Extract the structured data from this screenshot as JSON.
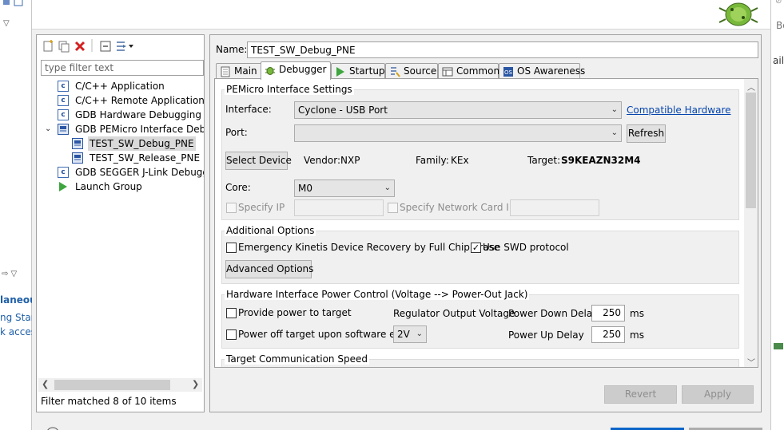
{
  "background": {
    "left_fragments": [
      "laneous",
      "ng Start",
      "k access"
    ],
    "right_fragments": [
      "Bo",
      "aila"
    ]
  },
  "left": {
    "filter_placeholder": "type filter text",
    "tree": [
      {
        "label": "C/C++ Application"
      },
      {
        "label": "C/C++ Remote Application"
      },
      {
        "label": "GDB Hardware Debugging"
      },
      {
        "label": "GDB PEMicro Interface Debugging"
      },
      {
        "label": "TEST_SW_Debug_PNE"
      },
      {
        "label": "TEST_SW_Release_PNE"
      },
      {
        "label": "GDB SEGGER J-Link Debugging"
      },
      {
        "label": "Launch Group"
      }
    ],
    "status": "Filter matched 8 of 10 items"
  },
  "right": {
    "name_label": "Name:",
    "name_value": "TEST_SW_Debug_PNE",
    "tabs": [
      "Main",
      "Debugger",
      "Startup",
      "Source",
      "Common",
      "OS Awareness"
    ],
    "pemicro": {
      "title": "PEMicro Interface Settings",
      "interface_label": "Interface:",
      "interface_value": "Cyclone - USB Port",
      "compat_link": "Compatible Hardware",
      "port_label": "Port:",
      "refresh": "Refresh",
      "select_device": "Select Device",
      "vendor_label": "Vendor:",
      "vendor_value": "NXP",
      "family_label": "Family:",
      "family_value": "KEx",
      "target_label": "Target:",
      "target_value": "S9KEAZN32M4",
      "core_label": "Core:",
      "core_value": "M0",
      "specify_ip": "Specify IP",
      "specify_network": "Specify Network Card IP"
    },
    "additional": {
      "title": "Additional Options",
      "emergency": "Emergency Kinetis Device Recovery by Full Chip Erase",
      "use_swd": "Use SWD protocol",
      "advanced": "Advanced Options"
    },
    "power": {
      "title": "Hardware Interface Power Control (Voltage --> Power-Out Jack)",
      "provide": "Provide power to target",
      "regulator": "Regulator Output Voltage",
      "power_down_label": "Power Down Delay",
      "power_down_value": "250",
      "ms1": "ms",
      "power_off": "Power off target upon software exit",
      "voltage": "2V",
      "power_up_label": "Power Up Delay",
      "power_up_value": "250",
      "ms2": "ms"
    },
    "speed_title": "Target Communication Speed",
    "revert": "Revert",
    "apply": "Apply"
  }
}
